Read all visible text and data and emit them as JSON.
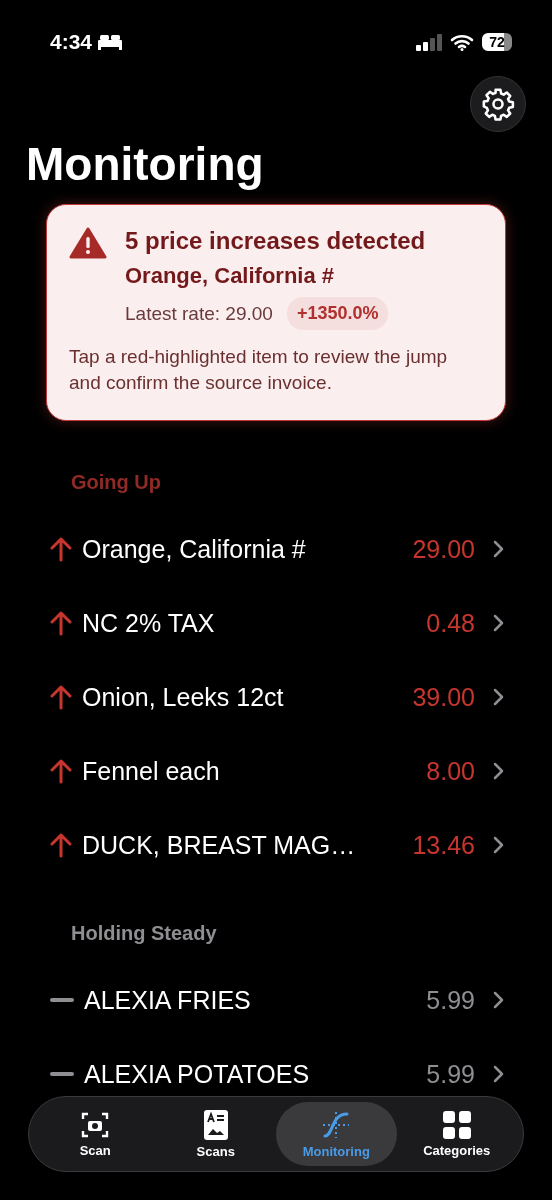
{
  "status_bar": {
    "time": "4:34",
    "battery": "72"
  },
  "title": "Monitoring",
  "alert": {
    "headline": "5 price increases detected",
    "item": "Orange, California #",
    "rate": "Latest rate: 29.00",
    "change": "+1350.0%",
    "hint": "Tap a red-highlighted item to review the jump and confirm the source invoice."
  },
  "sections": [
    {
      "title": "Going Up",
      "kind": "up",
      "rows": [
        {
          "name": "Orange, California #",
          "price": "29.00"
        },
        {
          "name": "NC 2% TAX",
          "price": "0.48"
        },
        {
          "name": "Onion, Leeks 12ct",
          "price": "39.00"
        },
        {
          "name": "Fennel each",
          "price": "8.00"
        },
        {
          "name": "DUCK, BREAST MAG…",
          "price": "13.46"
        }
      ]
    },
    {
      "title": "Holding Steady",
      "kind": "steady",
      "rows": [
        {
          "name": "ALEXIA FRIES",
          "price": "5.99"
        },
        {
          "name": "ALEXIA POTATOES",
          "price": "5.99"
        }
      ]
    }
  ],
  "tabs": [
    {
      "label": "Scan",
      "kind": "scan",
      "selected": false
    },
    {
      "label": "Scans",
      "kind": "scans",
      "selected": false
    },
    {
      "label": "Monitoring",
      "kind": "monitoring",
      "selected": true
    },
    {
      "label": "Categories",
      "kind": "categories",
      "selected": false
    }
  ]
}
